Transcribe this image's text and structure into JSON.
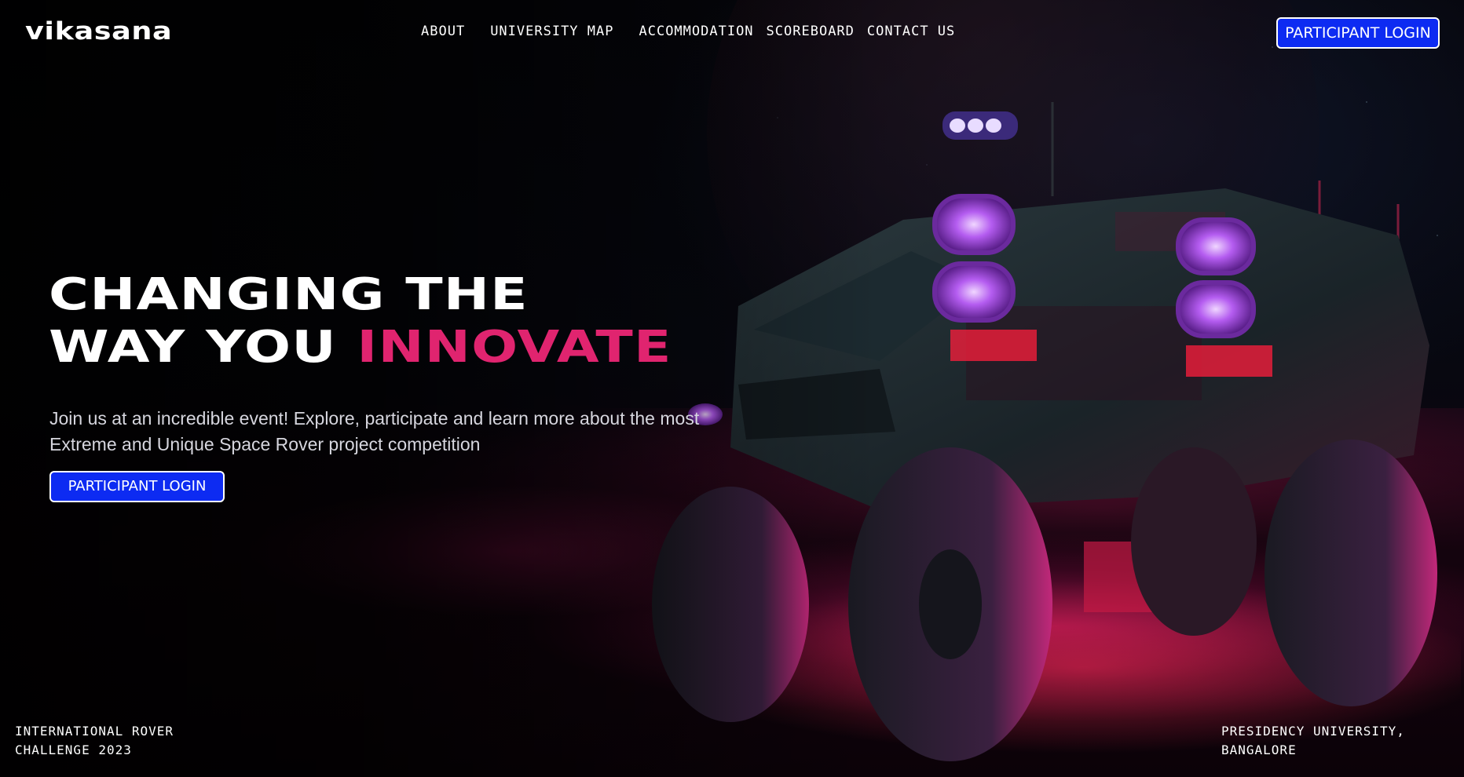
{
  "brand": {
    "logo_text": "vikasana"
  },
  "nav": {
    "items": [
      {
        "label": "ABOUT"
      },
      {
        "label": "UNIVERSITY MAP"
      },
      {
        "label": "ACCOMMODATION"
      },
      {
        "label": "SCOREBOARD"
      },
      {
        "label": "CONTACT US"
      }
    ],
    "login_label": "PARTICIPANT LOGIN"
  },
  "hero": {
    "title_line1": "CHANGING THE",
    "title_line2_plain": "WAY YOU ",
    "title_line2_accent": "INNOVATE",
    "subtitle_line1": "Join us at an incredible event! Explore, participate and learn more about the most",
    "subtitle_line2": "Extreme and Unique Space Rover project competition",
    "cta_label": "PARTICIPANT LOGIN"
  },
  "footer": {
    "left_line1": "INTERNATIONAL ROVER",
    "left_line2": "CHALLENGE 2023",
    "right_line1": "PRESIDENCY UNIVERSITY,",
    "right_line2": "BANGALORE"
  },
  "colors": {
    "accent": "#e0246f",
    "button": "#0d2bf2",
    "background": "#030305"
  },
  "images": {
    "hero_background": "space-rover-illustration"
  }
}
